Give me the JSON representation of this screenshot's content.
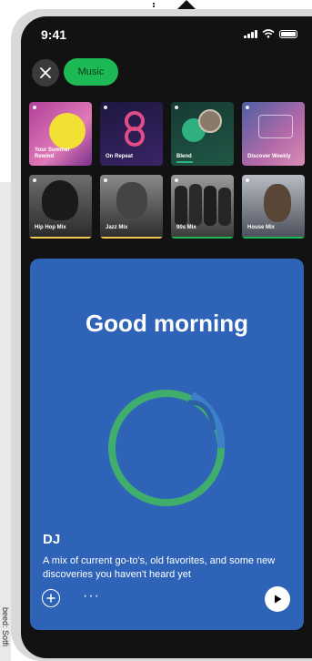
{
  "status_bar": {
    "time": "9:41"
  },
  "header": {
    "close_icon": "close-icon",
    "filter_chip": "Music"
  },
  "tiles_row1": [
    {
      "label": "Your Summer Rewind",
      "colors": [
        "#c85aa5",
        "#f0e030"
      ]
    },
    {
      "label": "On Repeat",
      "colors": [
        "#2a1a5e",
        "#e0507a"
      ]
    },
    {
      "label": "Blend",
      "colors": [
        "#1f4a3e",
        "#2fa37a"
      ]
    },
    {
      "label": "Discover Weekly",
      "colors": [
        "#6a7dbf",
        "#d46aa0"
      ]
    }
  ],
  "tiles_row2": [
    {
      "label": "Hip Hop Mix",
      "underline": "#f2c94c"
    },
    {
      "label": "Jazz Mix",
      "underline": "#f2c94c"
    },
    {
      "label": "90s Mix",
      "underline": "#1db954"
    },
    {
      "label": "House Mix",
      "underline": "#1db954"
    }
  ],
  "dj_card": {
    "greeting": "Good morning",
    "title": "DJ",
    "description": "A mix of current go-to's, old favorites, and some new discoveries you haven't heard yet",
    "more": "···",
    "add_icon": "plus-circle-icon",
    "play_icon": "play-icon",
    "bg_color": "#2e63b8",
    "ring_color": "#32a86a"
  },
  "side_caption": "beed: Sotfi"
}
